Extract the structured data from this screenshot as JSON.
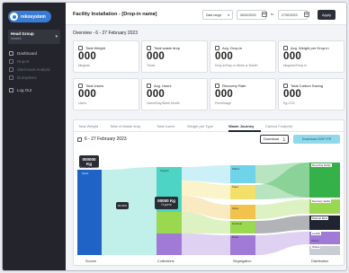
{
  "sidebar": {
    "logo_text": "rekosystem",
    "company": {
      "name": "Head Group",
      "sub": "Intratek"
    },
    "items": [
      {
        "label": "Dashboard"
      },
      {
        "label": "Report"
      },
      {
        "label": "Site/Asset Analytic"
      },
      {
        "label": "Dumpsters"
      },
      {
        "label": "Log Out"
      }
    ]
  },
  "header": {
    "title": "Facility Installation - [Drop-in name]",
    "date_select": "Date range",
    "date_from": "06/02/2023",
    "to_label": "to",
    "date_to": "27/02/2023",
    "apply_label": "Apply"
  },
  "overview": {
    "label": "Overview - 6 - 27 February 2023"
  },
  "cards": [
    {
      "title": "Total Weight",
      "value": "000",
      "unit": "kilogram"
    },
    {
      "title": "Total waste drop",
      "value": "000",
      "unit": "Times"
    },
    {
      "title": "Avg. Drop-in",
      "value": "000",
      "unit": "Drop-in/Day or Week or Month"
    },
    {
      "title": "Avg. Weight per Drop-in",
      "value": "000",
      "unit": "kilogram/Drop-in"
    },
    {
      "title": "Total Users",
      "value": "000",
      "unit": "Users"
    },
    {
      "title": "Avg. Users",
      "value": "000",
      "unit": "Users/Day,Week,Month"
    },
    {
      "title": "Recovery Rate",
      "value": "000",
      "unit": "Percentage"
    },
    {
      "title": "Total Carbon Saving",
      "value": "000",
      "unit": "Kg-CO2"
    }
  ],
  "panel": {
    "tabs": [
      "Total Weight",
      "Total of Waste drop",
      "Total Users",
      "Weight per Type",
      "Waste Journey",
      "Carbon Footprint"
    ],
    "active_tab": 4,
    "date_label": "6 - 27 February 2023",
    "download_label": "Download",
    "download2_label": "Download DGP-FR"
  },
  "sankey": {
    "stage_labels": [
      "Source",
      "Collections",
      "Segregation",
      "Distribution"
    ],
    "tooltips": [
      {
        "value": "000000 Kg",
        "sub": "Drop-in name"
      },
      {
        "value": "00000 Kg",
        "sub": "Organic"
      },
      {
        "value": "00.00%",
        "sub": ""
      }
    ],
    "node_labels": [
      "Users",
      "Organic",
      "Plastic",
      "Paper",
      "Glass",
      "Residual",
      "Metal",
      "Others"
    ],
    "right_labels": [
      "Recycling facility",
      "Recovery facility",
      "Material Bank",
      "Landfill",
      "Others"
    ],
    "colors": {
      "source": "#1f63c6",
      "organic": "#9ad94f",
      "teal": "#4dd4c4",
      "cyan": "#6fd3ea",
      "yellow": "#f3e06a",
      "orange": "#f2c24c",
      "purple": "#a07ad6",
      "green": "#35b14a",
      "dark": "#1f2430"
    }
  }
}
